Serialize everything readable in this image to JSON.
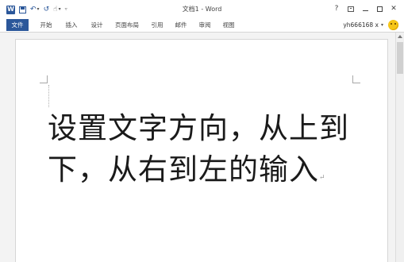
{
  "app": {
    "title": "文档1 - Word",
    "help_label": "?",
    "close_label": "✕"
  },
  "quick_access": {
    "word_icon": "W",
    "undo_label": "↶",
    "redo_label": "↺",
    "icons": [
      "word-logo-icon",
      "save-icon",
      "undo-icon",
      "redo-icon",
      "touch-mode-icon",
      "customize-qat-icon"
    ]
  },
  "ribbon": {
    "tabs": [
      {
        "label": "文件"
      },
      {
        "label": "开始"
      },
      {
        "label": "插入"
      },
      {
        "label": "设计"
      },
      {
        "label": "页面布局"
      },
      {
        "label": "引用"
      },
      {
        "label": "邮件"
      },
      {
        "label": "审阅"
      },
      {
        "label": "视图"
      }
    ]
  },
  "account": {
    "username": "yh666168 x"
  },
  "document": {
    "lines": [
      "设置文字方向，从上到",
      "下，从右到左的输入"
    ],
    "paragraph_mark": "↵"
  },
  "colors": {
    "accent": "#2b579a",
    "background": "#f3f3f3",
    "page": "#ffffff"
  }
}
